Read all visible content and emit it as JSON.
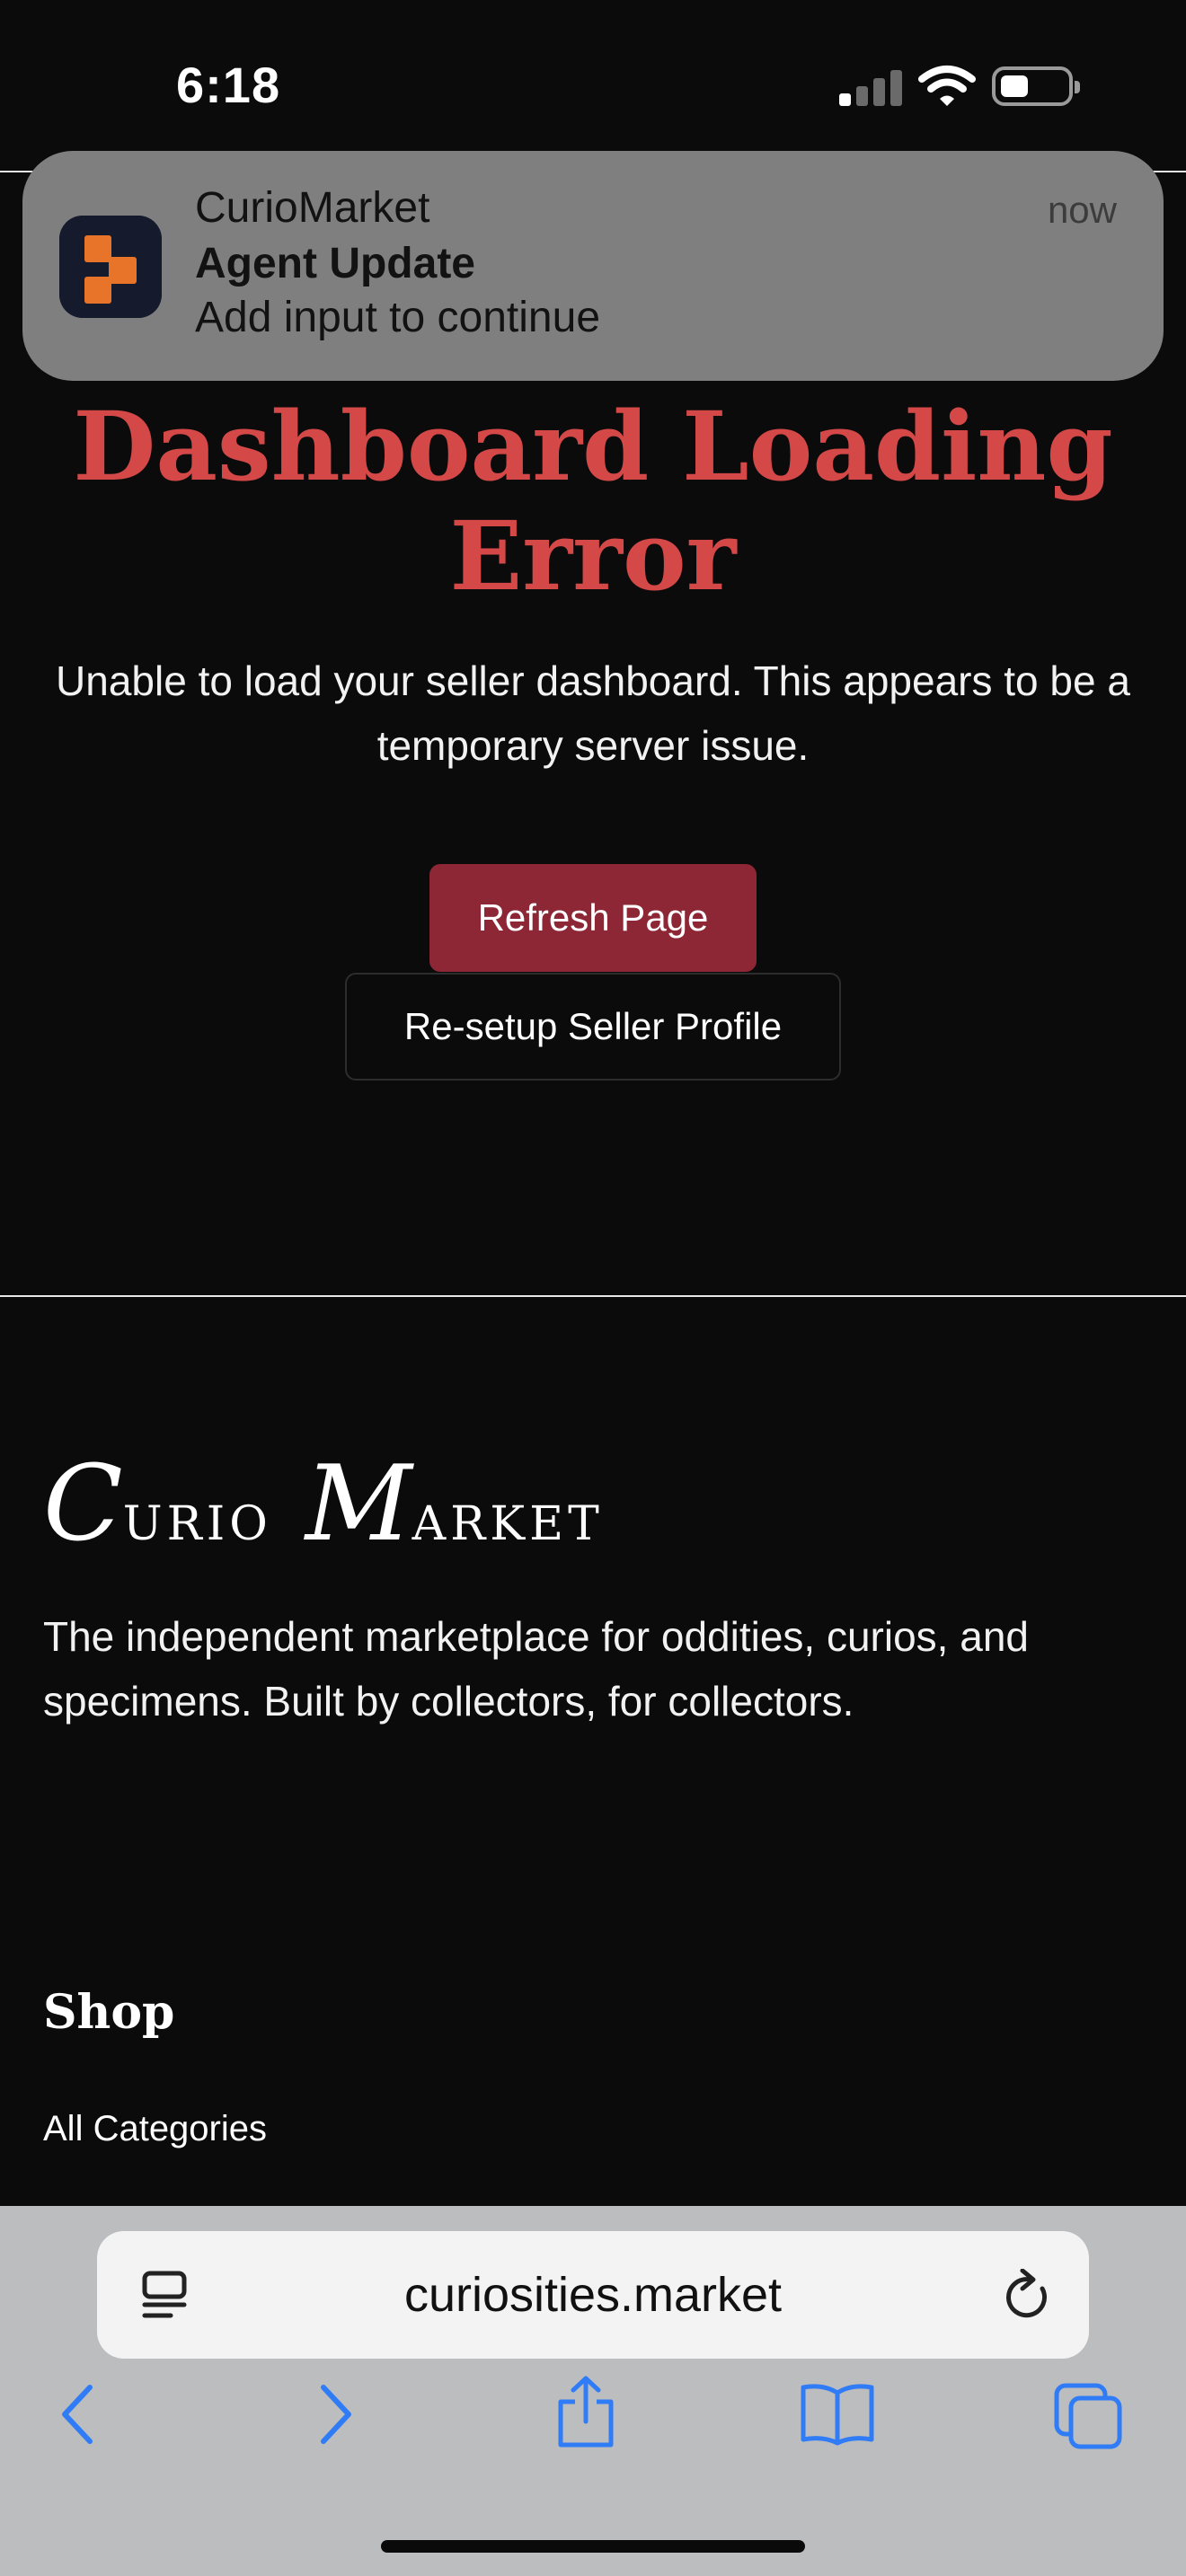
{
  "status_bar": {
    "time": "6:18"
  },
  "notification": {
    "app_name": "CurioMarket",
    "title": "Agent Update",
    "body": "Add input to continue",
    "time": "now"
  },
  "error": {
    "title": "Dashboard Loading Error",
    "message": "Unable to load your seller dashboard. This appears to be a temporary server issue.",
    "refresh_label": "Refresh Page",
    "resetup_label": "Re-setup Seller Profile"
  },
  "footer": {
    "logo": {
      "first_initial": "C",
      "first_rest": "urio",
      "second_initial": "M",
      "second_rest": "arket"
    },
    "tagline": "The independent marketplace for oddities, curios, and specimens. Built by collectors, for collectors.",
    "shop_heading": "Shop",
    "shop_links": [
      "All Categories"
    ]
  },
  "browser": {
    "url": "curiosities.market",
    "icons": [
      "tab-overview-icon",
      "reload-icon",
      "back-icon",
      "forward-icon",
      "share-icon",
      "bookmarks-icon",
      "tabs-icon"
    ]
  },
  "colors": {
    "background": "#0b0b0c",
    "error_red": "#d44848",
    "primary_button": "#8e2735",
    "browser_tint": "#2f7cf6",
    "app_icon_orange": "#e8742a"
  }
}
